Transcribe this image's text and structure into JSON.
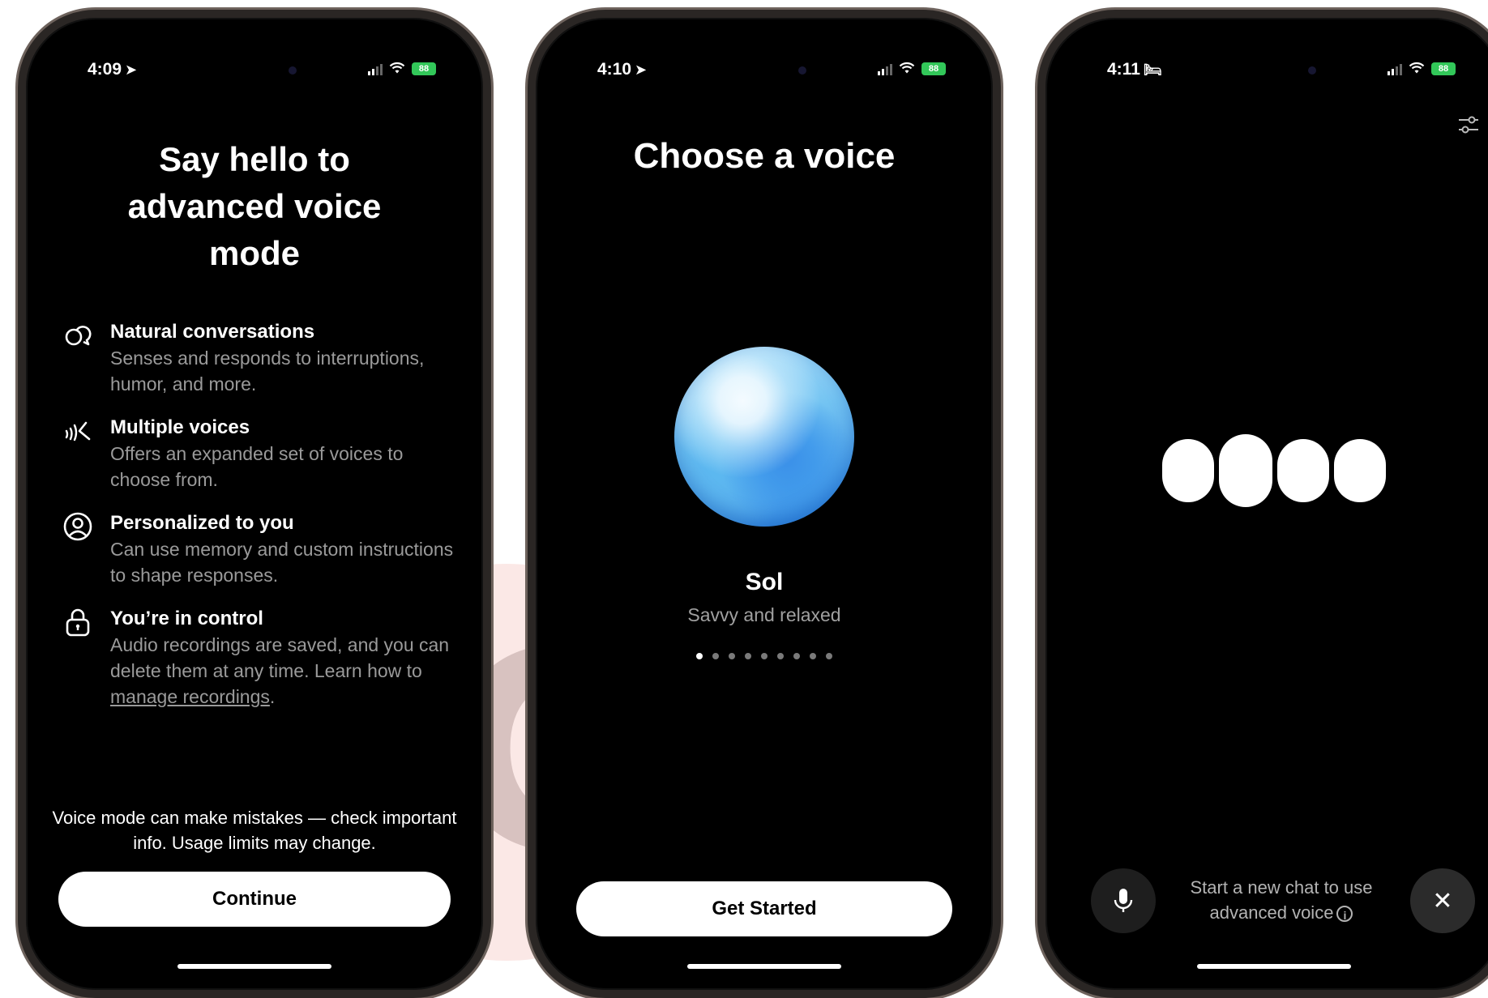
{
  "phone1": {
    "status": {
      "time": "4:09",
      "time_glyph": "➤",
      "battery": "88"
    },
    "title": "Say hello to advanced voice mode",
    "features": [
      {
        "icon": "chat-bubbles-icon",
        "title": "Natural conversations",
        "desc": "Senses and responds to interruptions, humor, and more."
      },
      {
        "icon": "voice-waves-icon",
        "title": "Multiple voices",
        "desc": "Offers an expanded set of voices to choose from."
      },
      {
        "icon": "person-circle-icon",
        "title": "Personalized to you",
        "desc": "Can use memory and custom instructions to shape responses."
      },
      {
        "icon": "lock-icon",
        "title": "You’re in control",
        "desc": "Audio recordings are saved, and you can delete them at any time. Learn how to ",
        "link": "manage recordings",
        "after_link": "."
      }
    ],
    "disclaimer": "Voice mode can make mistakes — check important info. Usage limits may change.",
    "continue_label": "Continue"
  },
  "phone2": {
    "status": {
      "time": "4:10",
      "time_glyph": "➤",
      "battery": "88"
    },
    "title": "Choose a voice",
    "voice_name": "Sol",
    "voice_desc": "Savvy and relaxed",
    "page_count": 9,
    "active_page": 1,
    "button_label": "Get Started"
  },
  "phone3": {
    "status": {
      "time": "4:11",
      "time_glyph": "🛏",
      "battery": "88"
    },
    "hint": "Start a new chat to use advanced voice",
    "close_glyph": "✕"
  },
  "colors": {
    "background": "#000000",
    "button": "#ffffff",
    "battery": "#32c759",
    "secondary_text": "#9a9a9a",
    "orb_blue": "#2c86e3"
  }
}
